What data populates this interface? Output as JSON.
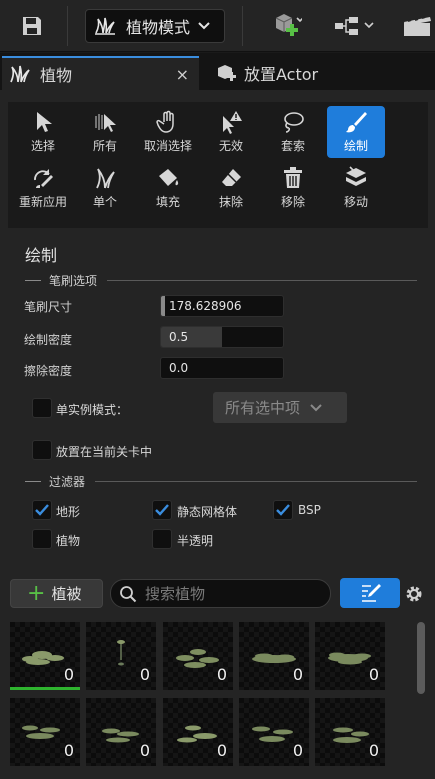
{
  "toolbar": {
    "save_icon": "save-icon",
    "mode_label": "植物模式",
    "icons": [
      "add-actor-icon",
      "blueprint-icon",
      "cinematics-icon"
    ]
  },
  "tabs": [
    {
      "label": "植物",
      "close": "×"
    },
    {
      "label": "放置Actor"
    }
  ],
  "tools": [
    {
      "label": "选择",
      "icon": "select-cursor-icon"
    },
    {
      "label": "所有",
      "icon": "select-all-icon"
    },
    {
      "label": "取消选择",
      "icon": "deselect-hand-icon"
    },
    {
      "label": "无效",
      "icon": "invalid-warning-icon"
    },
    {
      "label": "套索",
      "icon": "lasso-icon"
    },
    {
      "label": "绘制",
      "icon": "paint-brush-icon",
      "active": true
    },
    {
      "label": "重新应用",
      "icon": "reapply-icon"
    },
    {
      "label": "单个",
      "icon": "single-instance-icon"
    },
    {
      "label": "填充",
      "icon": "fill-bucket-icon"
    },
    {
      "label": "抹除",
      "icon": "erase-icon"
    },
    {
      "label": "移除",
      "icon": "trash-icon"
    },
    {
      "label": "移动",
      "icon": "move-icon"
    }
  ],
  "paint": {
    "title": "绘制",
    "brush_group": "笔刷选项",
    "brush_size_label": "笔刷尺寸",
    "brush_size": "178.628906",
    "paint_density_label": "绘制密度",
    "paint_density": "0.5",
    "paint_density_fraction": 0.5,
    "erase_density_label": "擦除密度",
    "erase_density": "0.0",
    "single_instance_label": "单实例模式：",
    "single_instance_dropdown": "所有选中项",
    "place_in_level_label": "放置在当前关卡中",
    "filter_group": "过滤器",
    "filters": [
      {
        "label": "地形",
        "checked": true
      },
      {
        "label": "静态网格体",
        "checked": true
      },
      {
        "label": "BSP",
        "checked": true
      },
      {
        "label": "植物",
        "checked": false
      },
      {
        "label": "半透明",
        "checked": false
      }
    ]
  },
  "foliage": {
    "add_label": "植被",
    "search_placeholder": "搜索植物",
    "thumbnails": [
      {
        "count": "0"
      },
      {
        "count": "0"
      },
      {
        "count": "0"
      },
      {
        "count": "0"
      },
      {
        "count": "0"
      },
      {
        "count": "0"
      },
      {
        "count": "0"
      },
      {
        "count": "0"
      },
      {
        "count": "0"
      },
      {
        "count": "0"
      }
    ]
  },
  "colors": {
    "accent": "#1f7ddb",
    "active_bar": "#2fb52f",
    "panel": "#242424"
  }
}
